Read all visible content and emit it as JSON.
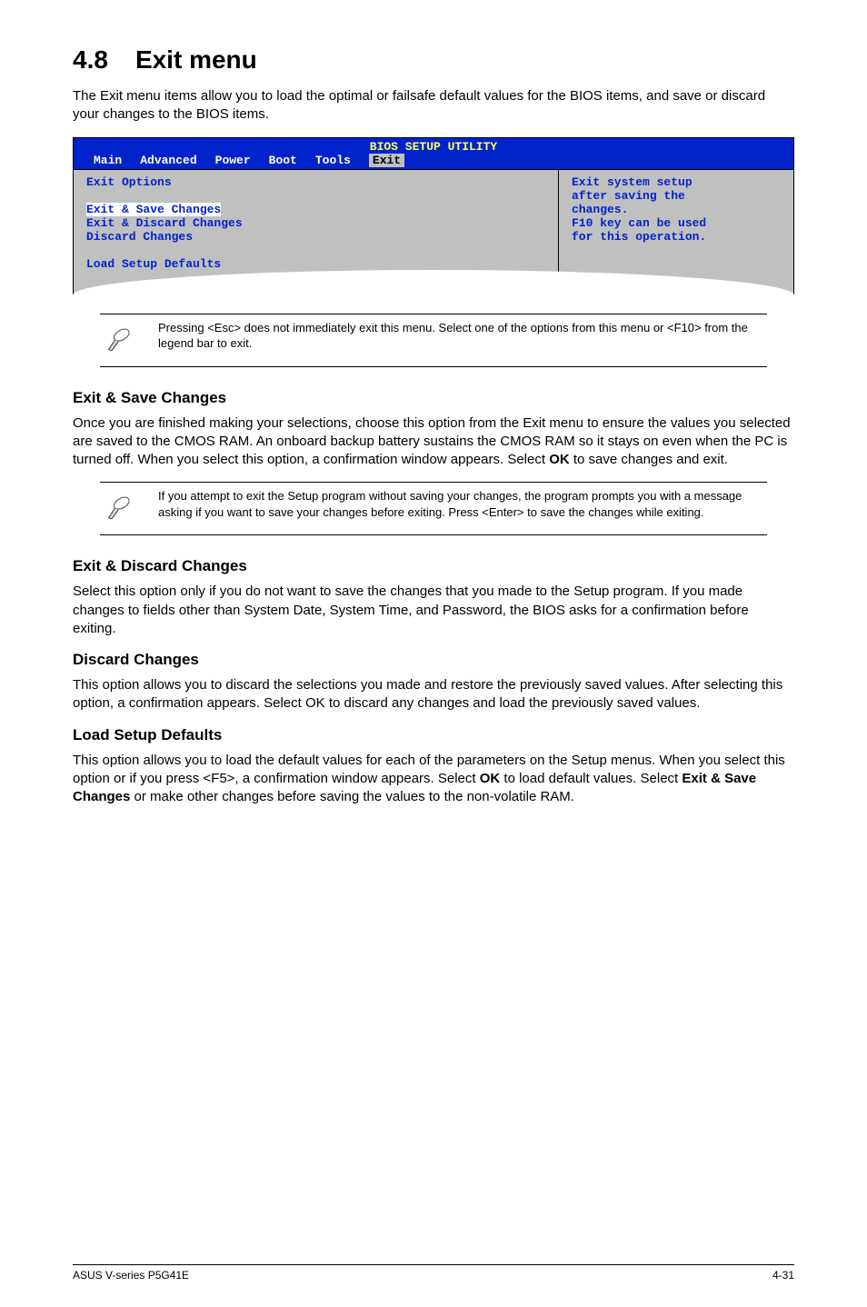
{
  "heading": {
    "number": "4.8",
    "title": "Exit menu"
  },
  "intro": "The Exit menu items allow you to load the optimal or failsafe default values for the BIOS items, and save or discard your changes to the BIOS items.",
  "bios": {
    "title": "BIOS SETUP UTILITY",
    "tabs": [
      "Main",
      "Advanced",
      "Power",
      "Boot",
      "Tools",
      "Exit"
    ],
    "left_heading": "Exit Options",
    "left_items": [
      "Exit & Save Changes",
      "Exit & Discard Changes",
      "Discard Changes",
      "Load Setup Defaults"
    ],
    "help": [
      "Exit system setup",
      "after saving the",
      "changes.",
      "",
      "F10 key can be used",
      "for this operation."
    ]
  },
  "note1": "Pressing <Esc> does not immediately exit this menu. Select one of the options from this menu or <F10> from the legend bar to exit.",
  "sections": {
    "save": {
      "title": "Exit & Save Changes",
      "text_pre": "Once you are finished making your selections, choose this option from the Exit menu to ensure the values you selected are saved to the CMOS RAM. An onboard backup battery sustains the CMOS RAM so it stays on even when the PC is turned off. When you select this option, a confirmation window appears. Select ",
      "ok": "OK",
      "text_post": " to save changes and exit."
    },
    "note2": " If you attempt to exit the Setup program without saving your changes, the program prompts you with a message asking if you want to save your changes before exiting. Press <Enter>  to save the  changes while exiting.",
    "discard_exit": {
      "title": "Exit & Discard Changes",
      "text": "Select this option only if you do not want to save the changes that you  made to the Setup program. If you made changes to fields other than System Date, System Time, and Password, the BIOS asks for a confirmation before exiting."
    },
    "discard": {
      "title": "Discard Changes",
      "text_pre": "This option allows you to discard the selections you made and restore the previously saved values. After selecting this option, a confirmation appears. Select ",
      "ok": "OK",
      "text_post": " to discard any changes and load the previously saved values."
    },
    "defaults": {
      "title": "Load Setup Defaults",
      "text_pre": "This option allows you to load the default values for each of the parameters on the Setup menus. When you select this option or if you press <F5>, a confirmation window appears. Select ",
      "ok1": "OK",
      "mid": " to load default values. Select ",
      "exit_save": "Exit & Save Changes",
      "text_post": " or make other changes before saving the values to the non-volatile RAM."
    }
  },
  "footer": {
    "left": "ASUS V-series P5G41E",
    "right": "4-31"
  }
}
